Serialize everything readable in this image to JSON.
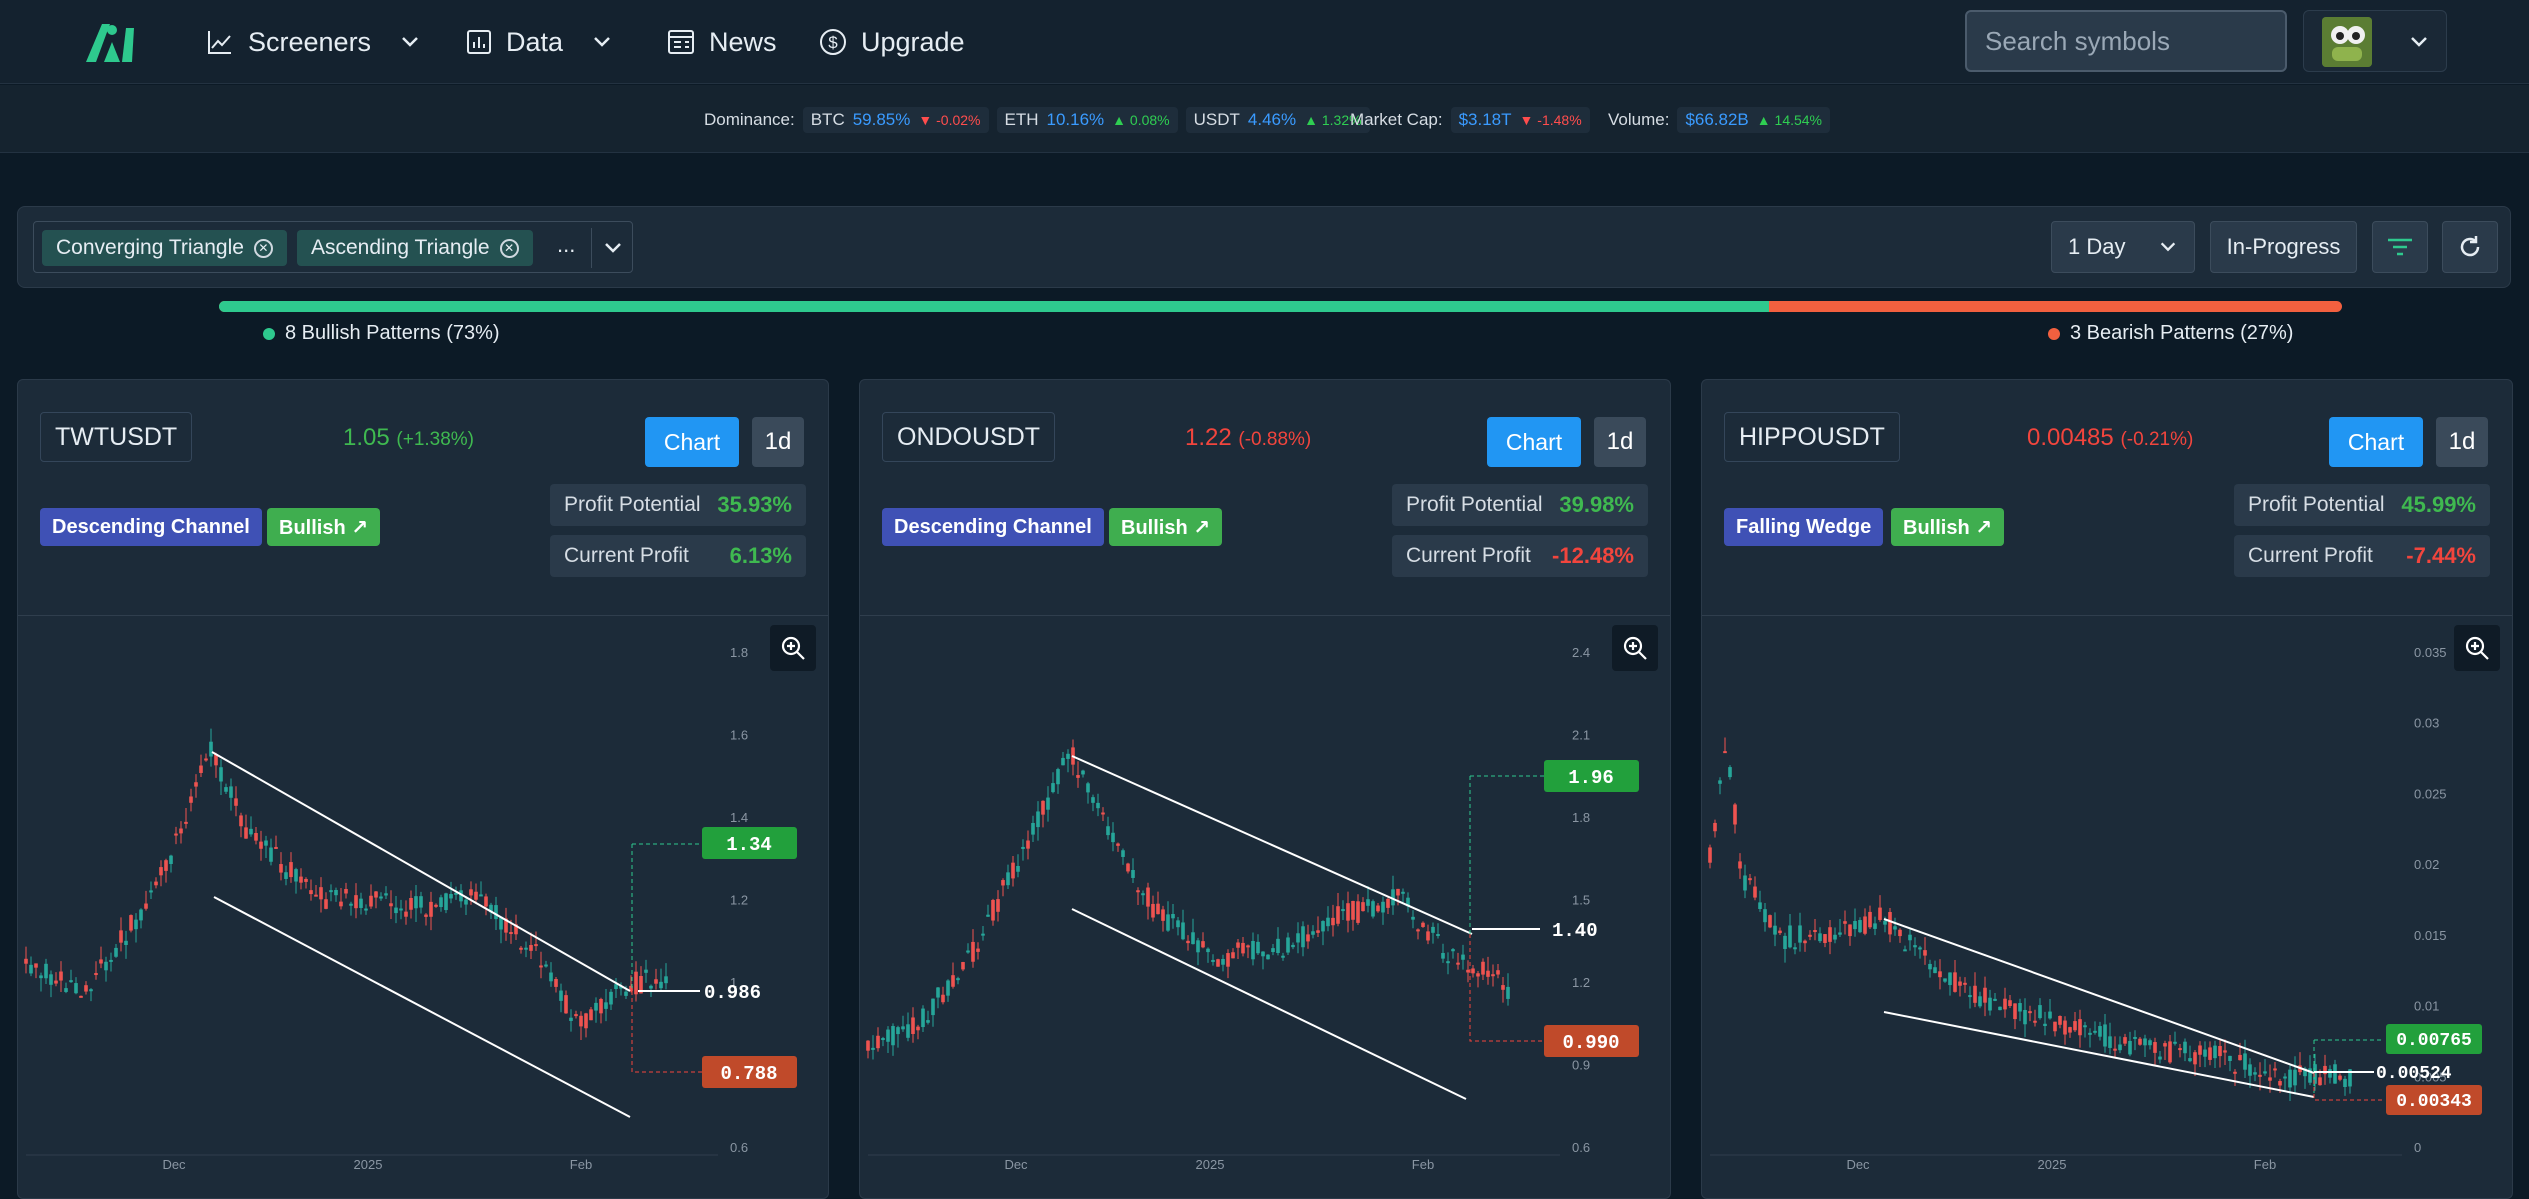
{
  "nav": {
    "items": [
      {
        "label": "Screeners",
        "icon": "chart-line-icon",
        "dropdown": true
      },
      {
        "label": "Data",
        "icon": "bar-chart-icon",
        "dropdown": true
      },
      {
        "label": "News",
        "icon": "newspaper-icon",
        "dropdown": false
      },
      {
        "label": "Upgrade",
        "icon": "dollar-circle-icon",
        "dropdown": false
      }
    ],
    "search_placeholder": "Search symbols"
  },
  "ticker": {
    "dominance_label": "Dominance:",
    "btc": {
      "label": "BTC",
      "value": "59.85%",
      "change": "▼ -0.02%"
    },
    "eth": {
      "label": "ETH",
      "value": "10.16%",
      "change": "▲ 0.08%"
    },
    "usdt": {
      "label": "USDT",
      "value": "4.46%",
      "change": "▲ 1.32%"
    },
    "marketcap": {
      "label": "Market Cap:",
      "value": "$3.18T",
      "change": "▼ -1.48%"
    },
    "volume": {
      "label": "Volume:",
      "value": "$66.82B",
      "change": "▲ 14.54%"
    }
  },
  "filters": {
    "chips": [
      "Converging Triangle",
      "Ascending Triangle"
    ],
    "more": "...",
    "timeframe": "1 Day",
    "status": "In-Progress"
  },
  "summary": {
    "bullish_label": "8 Bullish Patterns (73%)",
    "bearish_label": "3 Bearish Patterns (27%)",
    "bullish_fraction": 0.73
  },
  "colors": {
    "bullish": "#2ec98e",
    "bearish": "#f2603f",
    "accent": "#2196f3"
  },
  "cards": [
    {
      "symbol": "TWTUSDT",
      "price": "1.05",
      "change": "(+1.38%)",
      "direction": "up",
      "chart_label": "Chart",
      "timeframe": "1d",
      "pattern": "Descending Channel",
      "bias": "Bullish ↗",
      "profit_potential_label": "Profit Potential",
      "profit_potential": "35.93%",
      "current_profit_label": "Current Profit",
      "current_profit": "6.13%",
      "chart": {
        "x_ticks": [
          "Dec",
          "2025",
          "Feb"
        ],
        "y_ticks": [
          "1.8",
          "1.6",
          "1.4",
          "1.2",
          "1",
          "0.8",
          "0.6"
        ],
        "target": "1.34",
        "current": "0.986",
        "stop": "0.788"
      }
    },
    {
      "symbol": "ONDOUSDT",
      "price": "1.22",
      "change": "(-0.88%)",
      "direction": "down",
      "chart_label": "Chart",
      "timeframe": "1d",
      "pattern": "Descending Channel",
      "bias": "Bullish ↗",
      "profit_potential_label": "Profit Potential",
      "profit_potential": "39.98%",
      "current_profit_label": "Current Profit",
      "current_profit": "-12.48%",
      "chart": {
        "x_ticks": [
          "Dec",
          "2025",
          "Feb"
        ],
        "y_ticks": [
          "2.4",
          "2.1",
          "1.8",
          "1.5",
          "1.2",
          "0.9",
          "0.6"
        ],
        "target": "1.96",
        "current": "1.40",
        "stop": "0.990"
      }
    },
    {
      "symbol": "HIPPOUSDT",
      "price": "0.00485",
      "change": "(-0.21%)",
      "direction": "down",
      "chart_label": "Chart",
      "timeframe": "1d",
      "pattern": "Falling Wedge",
      "bias": "Bullish ↗",
      "profit_potential_label": "Profit Potential",
      "profit_potential": "45.99%",
      "current_profit_label": "Current Profit",
      "current_profit": "-7.44%",
      "chart": {
        "x_ticks": [
          "Dec",
          "2025",
          "Feb"
        ],
        "y_ticks": [
          "0.035",
          "0.03",
          "0.025",
          "0.02",
          "0.015",
          "0.01",
          "0.005",
          "0"
        ],
        "target": "0.00765",
        "current": "0.00524",
        "stop": "0.00343"
      }
    }
  ]
}
